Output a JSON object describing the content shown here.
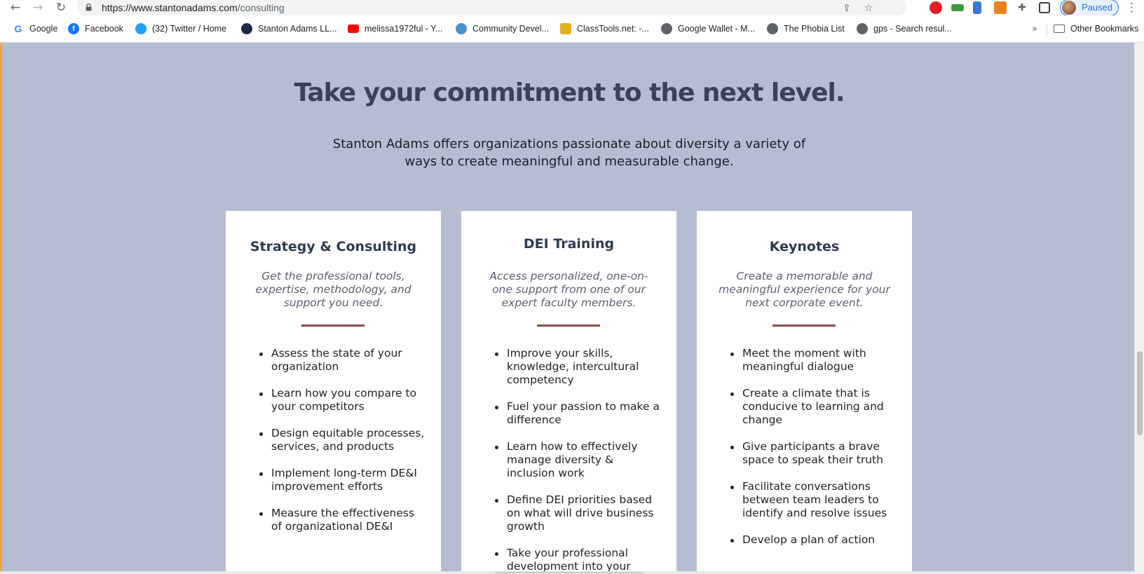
{
  "browser": {
    "url_host": "https://www.stantonadams.com",
    "url_path": "/consulting",
    "profile_label": "Paused",
    "bookmarks": [
      {
        "label": "Google",
        "icon": "google-icon",
        "color": "#4285f4"
      },
      {
        "label": "Facebook",
        "icon": "facebook-icon",
        "color": "#1877f2"
      },
      {
        "label": "(32) Twitter / Home",
        "icon": "twitter-icon",
        "color": "#1da1f2"
      },
      {
        "label": "Stanton Adams LL...",
        "icon": "stanton-adams-icon",
        "color": "#1c2b4a"
      },
      {
        "label": "melissa1972ful - Y...",
        "icon": "youtube-icon",
        "color": "#ff0000"
      },
      {
        "label": "Community Devel...",
        "icon": "community-icon",
        "color": "#4a8fc9"
      },
      {
        "label": "ClassTools.net: -...",
        "icon": "classtools-icon",
        "color": "#e0b020"
      },
      {
        "label": "Google Wallet - M...",
        "icon": "globe-icon",
        "color": "#5f6368"
      },
      {
        "label": "The Phobia List",
        "icon": "globe-icon",
        "color": "#5f6368"
      },
      {
        "label": "gps - Search resul...",
        "icon": "globe-icon",
        "color": "#5f6368"
      }
    ],
    "other_bookmarks": "Other Bookmarks"
  },
  "page": {
    "headline": "Take your commitment to the next level.",
    "subhead": "Stanton Adams offers organizations passionate about diversity a variety of ways to create meaningful and measurable change.",
    "accent_color": "#8a4a46",
    "background_color": "#b5bdd3",
    "cards": [
      {
        "title": "Strategy & Consulting",
        "description": "Get the professional tools, expertise, methodology, and support you need.",
        "items": [
          "Assess the state of your organization",
          "Learn how you compare to your competitors",
          "Design equitable processes, services, and products",
          "Implement long-term DE&I improvement efforts",
          "Measure the effectiveness of organizational DE&I"
        ]
      },
      {
        "title": "DEI Training",
        "description": "Access personalized, one-on-one support from one of our expert faculty members.",
        "items": [
          "Improve your skills, knowledge, intercultural competency",
          "Fuel your passion to make a difference",
          "Learn how to effectively manage diversity & inclusion work",
          "Define DEI priorities based on what will drive business growth",
          "Take your professional development into your"
        ]
      },
      {
        "title": "Keynotes",
        "description": "Create a memorable and meaningful experience for your next corporate event.",
        "items": [
          "Meet the moment with meaningful dialogue",
          "Create a climate that is conducive to learning and change",
          "Give participants a brave space to speak their truth",
          "Facilitate conversations between team leaders to identify and resolve issues",
          "Develop a plan of action"
        ]
      }
    ]
  }
}
